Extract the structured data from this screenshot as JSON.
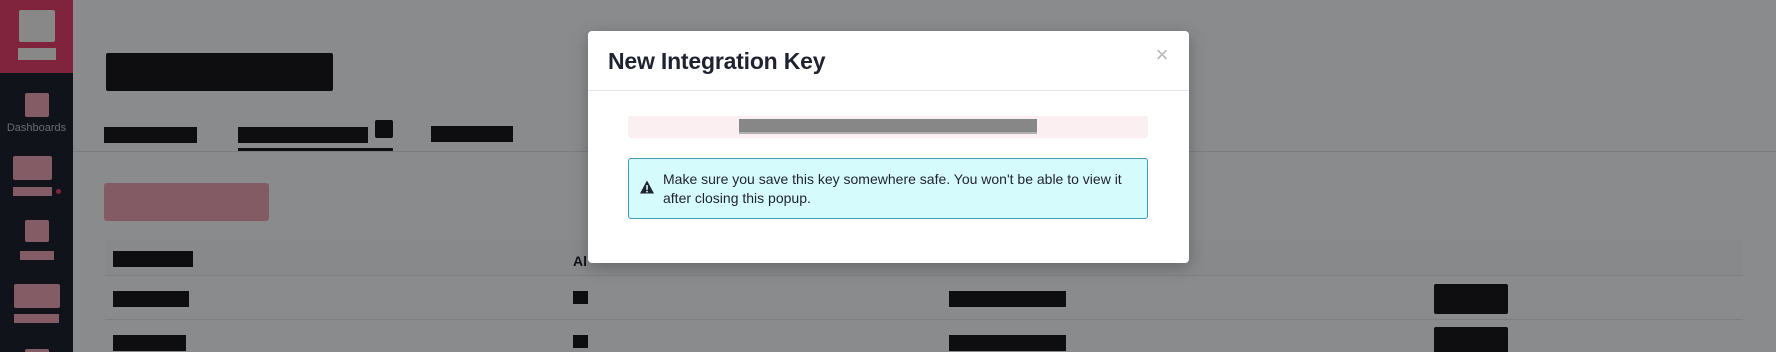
{
  "sidebar": {
    "items": [
      {
        "label": "Dashboards",
        "icon": "dashboard-icon"
      },
      {
        "label": "",
        "icon": "nav-icon"
      },
      {
        "label": "",
        "icon": "nav-icon"
      },
      {
        "label": "",
        "icon": "nav-icon"
      }
    ]
  },
  "table": {
    "columns": [
      "",
      "Al",
      "",
      ""
    ]
  },
  "modal": {
    "title": "New Integration Key",
    "close_label": "×",
    "alert_icon": "warning-icon",
    "alert_text": "Make sure you save this key somewhere safe. You won't be able to view it after closing this popup."
  },
  "colors": {
    "accent": "#e0406a",
    "alert_background": "#d6fbfc",
    "alert_border": "#3f9db6",
    "sidebar": "#1f2230"
  }
}
